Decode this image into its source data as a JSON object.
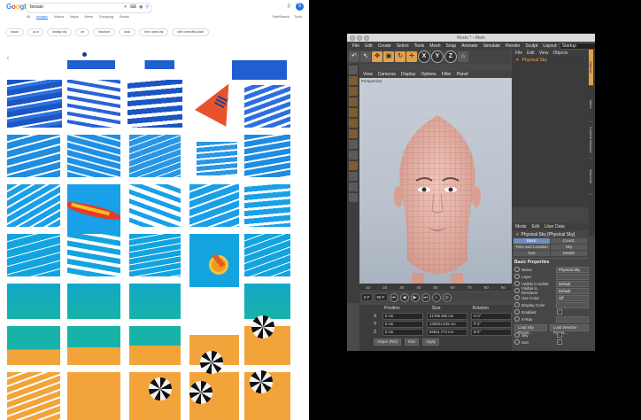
{
  "browser": {
    "logo": {
      "letters": [
        "G",
        "o",
        "o",
        "g",
        "l",
        "e"
      ],
      "colors": [
        "#4285f4",
        "#ea4335",
        "#fbbc05",
        "#4285f4",
        "#34a853",
        "#ea4335"
      ]
    },
    "search": {
      "query": "bosan"
    },
    "avatar_letter": "S",
    "tabs": [
      "All",
      "Images",
      "Videos",
      "Maps",
      "News",
      "Shopping",
      "Books"
    ],
    "tabs_right": [
      "SafeSearch",
      "Tools"
    ],
    "chips": [
      "bosan",
      "oc ai",
      "fantasy city",
      "art",
      "flowchart",
      "clock",
      "fire in peak city",
      "with a beautiful place"
    ],
    "carousel_arrow": "‹"
  },
  "c4d": {
    "window_title": "Rocio * - Main",
    "menu": [
      "File",
      "Edit",
      "Create",
      "Select",
      "Tools",
      "Mesh",
      "Snap",
      "Animate",
      "Simulate",
      "Render",
      "Sculpt"
    ],
    "layout": {
      "label": "Layout:",
      "value": "Startup"
    },
    "toolbar": [
      "↶",
      "↖",
      "✥",
      "▣",
      "↻",
      "✛",
      "X",
      "Y",
      "Z",
      "⌂"
    ],
    "viewport": {
      "menu": [
        "View",
        "Cameras",
        "Display",
        "Options",
        "Filter",
        "Panel"
      ],
      "camera_label": "Perspective"
    },
    "timeline_ticks": [
      "10",
      "20",
      "30",
      "40",
      "50",
      "60",
      "70",
      "80",
      "90"
    ],
    "frame": {
      "current": "0 F",
      "min": "0 F",
      "max": "90 F",
      "end": "90 F"
    },
    "coords": {
      "headers": [
        "Position",
        "Size",
        "Rotation"
      ],
      "rows": [
        {
          "axis": "X",
          "pos": "0 cm",
          "size": "41758.392 cm",
          "rot": "H 0°"
        },
        {
          "axis": "Y",
          "pos": "0 cm",
          "size": "130331.015 cm",
          "rot": "P 0°"
        },
        {
          "axis": "Z",
          "pos": "0 cm",
          "size": "69511.774 cm",
          "rot": "B 0°"
        }
      ],
      "mode": "Object (Rel)",
      "size_mode": "Size",
      "apply": "Apply"
    },
    "objects": {
      "menu": [
        "File",
        "Edit",
        "View",
        "Objects"
      ],
      "item": "Physical Sky"
    },
    "side_tabs": [
      "Objects",
      "Takes",
      "Content Browser",
      "Structure"
    ],
    "attributes": {
      "menu": [
        "Mode",
        "Edit",
        "User Data"
      ],
      "title": "Physical Sky [Physical Sky]",
      "tabs": [
        "Basic",
        "Coord.",
        "Time and Location",
        "Sky",
        "Sun",
        "Details"
      ],
      "section": "Basic Properties",
      "props": [
        {
          "label": "Name",
          "value": "Physical Sky"
        },
        {
          "label": "Layer",
          "value": ""
        },
        {
          "label": "Visible in Editor",
          "value": "Default"
        },
        {
          "label": "Visible in Renderer",
          "value": "Default"
        },
        {
          "label": "Use Color",
          "value": "Off"
        },
        {
          "label": "Display Color",
          "value": ""
        },
        {
          "label": "Enabled",
          "value": "✓"
        },
        {
          "label": "X-Ray",
          "value": ""
        }
      ],
      "buttons": [
        "Load Sky Preset...",
        "Load Weather Preset..."
      ],
      "toggles": [
        {
          "label": "Sky",
          "value": "✓"
        },
        {
          "label": "Sun",
          "value": "✓"
        }
      ]
    },
    "watermark": "MAXON CINEMA 4D"
  }
}
